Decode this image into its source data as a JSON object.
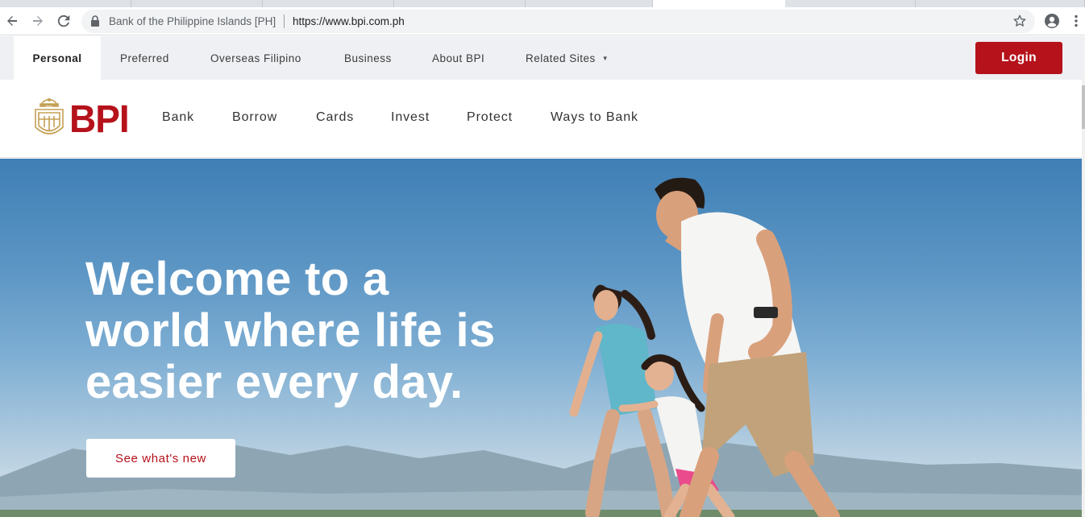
{
  "browser": {
    "site_name": "Bank of the Philippine Islands [PH]",
    "url": "https://www.bpi.com.ph",
    "icons": [
      "back-arrow-icon",
      "forward-arrow-icon",
      "reload-icon",
      "lock-icon",
      "bookmark-star-icon",
      "account-icon",
      "kebab-menu-icon"
    ]
  },
  "top_nav": {
    "items": [
      {
        "label": "Personal",
        "active": true
      },
      {
        "label": "Preferred"
      },
      {
        "label": "Overseas Filipino"
      },
      {
        "label": "Business"
      },
      {
        "label": "About BPI"
      },
      {
        "label": "Related Sites"
      }
    ],
    "login_label": "Login"
  },
  "main_nav": {
    "logo_text": "BPI",
    "seal_text": "BPI",
    "links": [
      "Bank",
      "Borrow",
      "Cards",
      "Invest",
      "Protect",
      "Ways to Bank"
    ]
  },
  "hero": {
    "title_lines": [
      "Welcome to a",
      "world where life is",
      "easier every day."
    ],
    "cta_label": "See what's new"
  },
  "colors": {
    "brand_red": "#b5121b",
    "logo_gold": "#c5a054",
    "topnav_bg": "#eef0f3"
  }
}
